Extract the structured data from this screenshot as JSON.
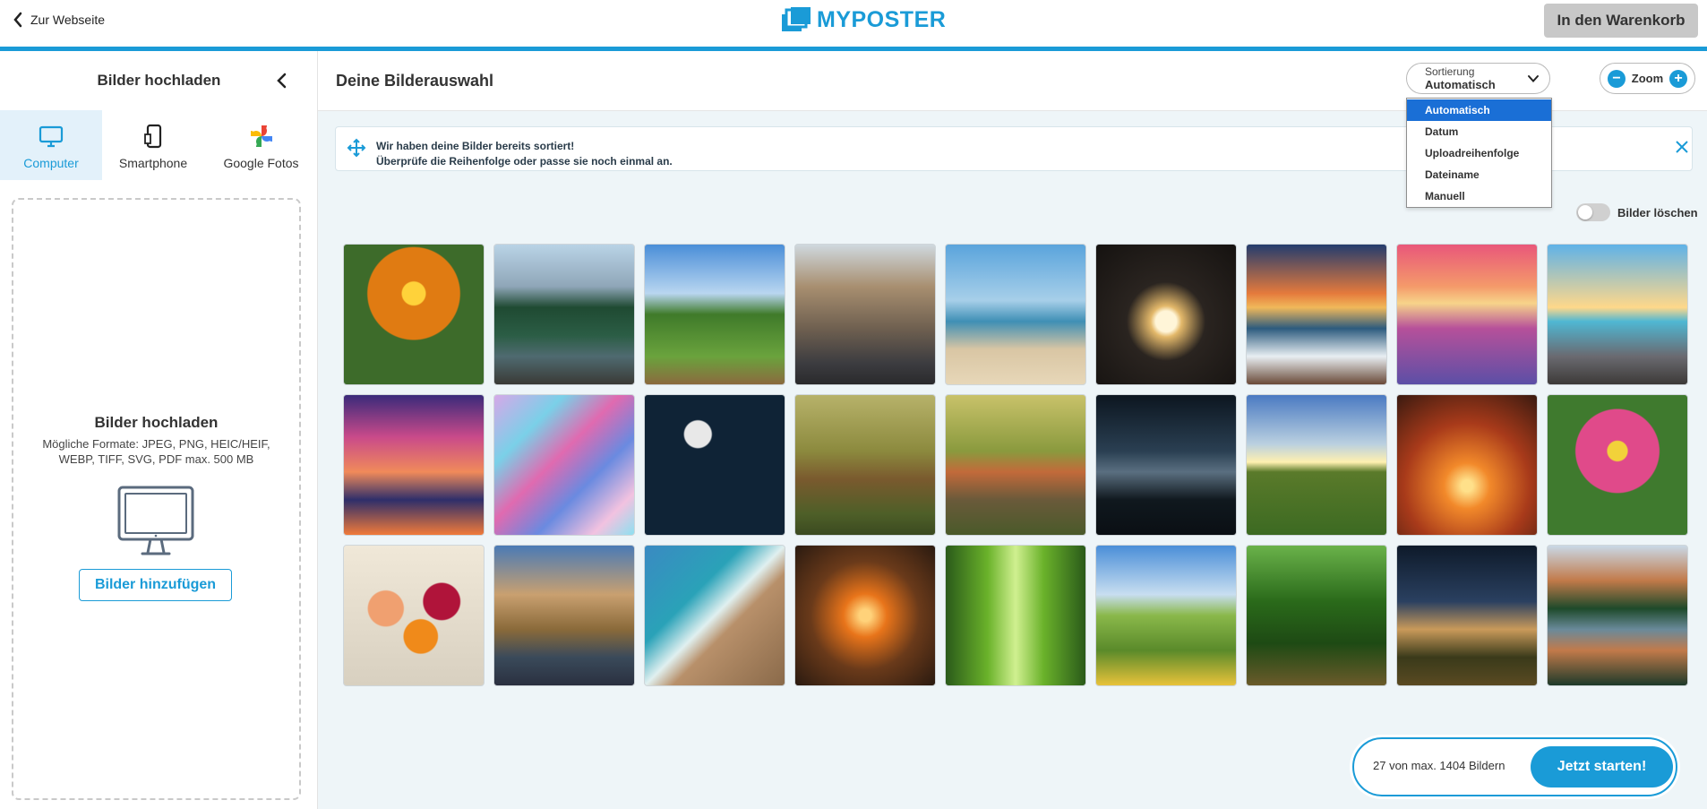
{
  "header": {
    "back_label": "Zur Webseite",
    "logo_text": "MYPOSTER",
    "cart_label": "In den Warenkorb",
    "accent_color": "#1a9bd7"
  },
  "left_panel": {
    "title": "Bilder hochladen",
    "tabs": [
      {
        "label": "Computer",
        "icon": "monitor-icon",
        "active": true
      },
      {
        "label": "Smartphone",
        "icon": "smartphone-icon",
        "active": false
      },
      {
        "label": "Google Fotos",
        "icon": "google-photos-icon",
        "active": false
      }
    ],
    "dropzone": {
      "title": "Bilder hochladen",
      "formats_line1": "Mögliche Formate: JPEG, PNG, HEIC/HEIF,",
      "formats_line2": "WEBP, TIFF, SVG, PDF max. 500 MB",
      "add_label": "Bilder hinzufügen"
    }
  },
  "main": {
    "title": "Deine Bilderauswahl",
    "sort": {
      "label": "Sortierung",
      "value": "Automatisch",
      "options": [
        "Automatisch",
        "Datum",
        "Uploadreihenfolge",
        "Dateiname",
        "Manuell"
      ],
      "selected_index": 0
    },
    "zoom": {
      "label": "Zoom",
      "minus": "−",
      "plus": "+"
    },
    "info": {
      "line1": "Wir haben deine Bilder bereits sortiert!",
      "line2": "Überprüfe die Reihenfolge oder passe sie noch einmal an."
    },
    "delete_toggle_label": "Bilder löschen",
    "images": [
      {
        "name": "orange-gerbera-photo",
        "bg": "radial-gradient(circle at 50% 35%, #ffd23a 0 10%, #e07b12 11% 40%, #3d6b2a 41% 100%)"
      },
      {
        "name": "mountain-lake-forest-photo",
        "bg": "linear-gradient(180deg, #b9d3e6 0%, #8fa6b8 30%, #1f4a32 45%, #2b5d45 65%, #4f6a70 80%, #3a3a36 100%)"
      },
      {
        "name": "meadow-path-photo",
        "bg": "linear-gradient(180deg, #4a8ed8 0%, #b9d6f0 35%, #3f7a2a 50%, #6aa33d 80%, #8b6a3e 100%)"
      },
      {
        "name": "city-street-church-photo",
        "bg": "linear-gradient(180deg, #cfd8de 0%, #a88f70 30%, #6f6050 60%, #3c3c40 85%, #2a2a2c 100%)"
      },
      {
        "name": "sandy-beach-photo",
        "bg": "linear-gradient(180deg, #5aa4dc 0%, #a7cfe9 40%, #3f8fb5 55%, #d9c6a4 75%, #e7d7b8 100%)"
      },
      {
        "name": "heart-hands-sunset-photo",
        "bg": "radial-gradient(circle at 50% 55%, #fff5d8 0 10%, #e3b86a 15%, #2a2420 38%, #151210 100%)"
      },
      {
        "name": "sunset-waves-photo",
        "bg": "linear-gradient(180deg, #233c6e 0%, #e57a3c 35%, #f0b85a 45%, #2d5b7e 60%, #e8eef2 80%, #6a4a38 100%)"
      },
      {
        "name": "pink-sunset-sea-photo",
        "bg": "linear-gradient(180deg, #e9577a 0%, #f49a6a 30%, #f7d48a 42%, #b6509a 60%, #5c4fa6 100%)"
      },
      {
        "name": "wooden-pier-photo",
        "bg": "linear-gradient(180deg, #5fb2e8 0%, #ffd88a 45%, #4fb7d3 55%, #6a6a70 80%, #3d3a38 100%)"
      },
      {
        "name": "purple-sky-lake-photo",
        "bg": "linear-gradient(180deg, #3a2a7a 0%, #c94a8a 30%, #f08a5a 55%, #2e2e6a 75%, #f07a3a 100%)"
      },
      {
        "name": "iridescent-abstract-photo",
        "bg": "linear-gradient(135deg, #d6a8e8 0%, #7ad0e8 25%, #e06ab0 45%, #6a8ae0 65%, #f2c2e0 85%, #8ee0f0 100%)"
      },
      {
        "name": "moon-night-sky-photo",
        "bg": "radial-gradient(circle at 38% 28%, #e8e8e8 0 10%, #0f2336 11% 100%)"
      },
      {
        "name": "fox-badger-rabbits-photo",
        "bg": "linear-gradient(180deg, #b7b26a 0%, #8c8a3e 40%, #7a5a2e 60%, #4e5f28 85%, #3b4a20 100%)"
      },
      {
        "name": "birds-on-branch-photo",
        "bg": "linear-gradient(180deg, #c9c26a 0%, #8a9a3e 40%, #c26a3a 55%, #6a5a3a 75%, #4a5a2a 100%)"
      },
      {
        "name": "milky-way-lake-photo",
        "bg": "linear-gradient(180deg, #0c1620 0%, #2a3f52 40%, #5a6f80 55%, #10181e 75%, #0a0f14 100%)"
      },
      {
        "name": "sunrise-field-photo",
        "bg": "linear-gradient(180deg, #4a7ac2 0%, #bad0e0 35%, #fff0b0 48%, #5a7a2a 55%, #3c6a22 100%)"
      },
      {
        "name": "orange-sunset-sea-photo",
        "bg": "radial-gradient(circle at 50% 65%, #ffe08a 0 5%, #f2892a 20%, #a83a1a 55%, #3a1a10 100%)"
      },
      {
        "name": "pink-flower-photo",
        "bg": "radial-gradient(circle at 50% 40%, #f2d23a 0 9%, #e04a8a 10% 38%, #3f7a2e 39% 100%)"
      },
      {
        "name": "flower-bouquet-photo",
        "bg": "radial-gradient(circle at 30% 45%, #f0a070 0 14%, transparent 15%), radial-gradient(circle at 70% 40%, #b0143a 0 14%, transparent 15%), radial-gradient(circle at 55% 65%, #f08a1a 0 14%, transparent 15%), linear-gradient(180deg, #f0e8d8 0%, #d8d0c0 100%)"
      },
      {
        "name": "castle-bridge-photo",
        "bg": "linear-gradient(180deg, #4a7ab5 0%, #c9a070 35%, #8a6a3a 60%, #3a4a5a 80%, #2a3040 100%)"
      },
      {
        "name": "rocky-coast-photo",
        "bg": "linear-gradient(135deg, #3a8ac2 0%, #2aa2b8 35%, #e0f0f0 50%, #b8906a 60%, #8a6a4a 100%)"
      },
      {
        "name": "sea-sunset-photo",
        "bg": "radial-gradient(circle at 50% 50%, #ffd27a 0 6%, #e8741a 22%, #6a3a1a 55%, #2a1a10 100%)"
      },
      {
        "name": "bamboo-forest-path-photo",
        "bg": "linear-gradient(90deg, #2a5a1a 0%, #6ab22a 30%, #d0f090 50%, #6ab22a 70%, #2a5a1a 100%)"
      },
      {
        "name": "flower-meadow-photo",
        "bg": "linear-gradient(180deg, #4a8ed8 0%, #c8def0 35%, #8ab84a 50%, #5a8a2a 75%, #e8c23a 100%)"
      },
      {
        "name": "forest-path-photo",
        "bg": "linear-gradient(180deg, #6ab24a 0%, #2a6a1a 40%, #1e4a14 70%, #6a5a2a 100%)"
      },
      {
        "name": "milky-way-field-photo",
        "bg": "linear-gradient(180deg, #0e1a2a 0%, #2a4060 40%, #c99a5a 60%, #3a3a1a 80%, #5a4a22 100%)"
      },
      {
        "name": "mountain-lake-reflection-photo",
        "bg": "linear-gradient(180deg, #c9d8e6 0%, #c27a4a 25%, #1e4a2a 45%, #6a8a9a 60%, #c27a4a 75%, #1e3a2a 100%)"
      }
    ],
    "count_text": "27 von max. 1404 Bildern",
    "start_label": "Jetzt starten!"
  }
}
